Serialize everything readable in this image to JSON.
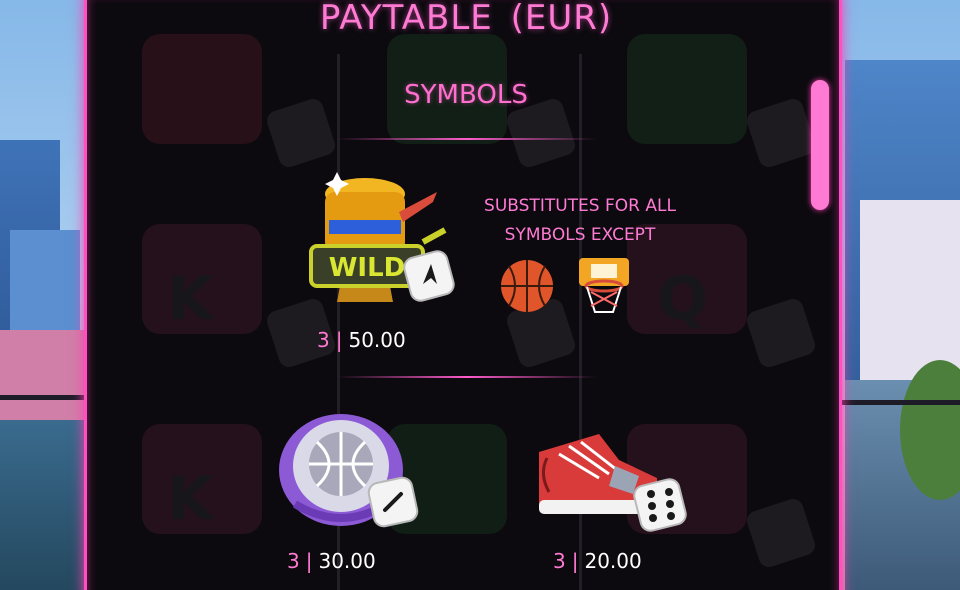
{
  "title": "PAYTABLE  (EUR)",
  "section_title": "SYMBOLS",
  "wild": {
    "count": "3",
    "separator": "|",
    "payout": "50.00",
    "text_line1": "SUBSTITUTES FOR ALL",
    "text_line2": "SYMBOLS EXCEPT",
    "badge_text": "WILD"
  },
  "symbols": [
    {
      "name": "championship-ring",
      "count": "3",
      "separator": "|",
      "payout": "30.00"
    },
    {
      "name": "sneaker",
      "count": "3",
      "separator": "|",
      "payout": "20.00"
    }
  ],
  "ghost_letters": [
    "K",
    "Q",
    "K"
  ],
  "colors": {
    "accent": "#ff7ad3",
    "panel_bg": "#0c0a0f",
    "border": "#ff4fc0",
    "value_text": "#ffffff"
  }
}
